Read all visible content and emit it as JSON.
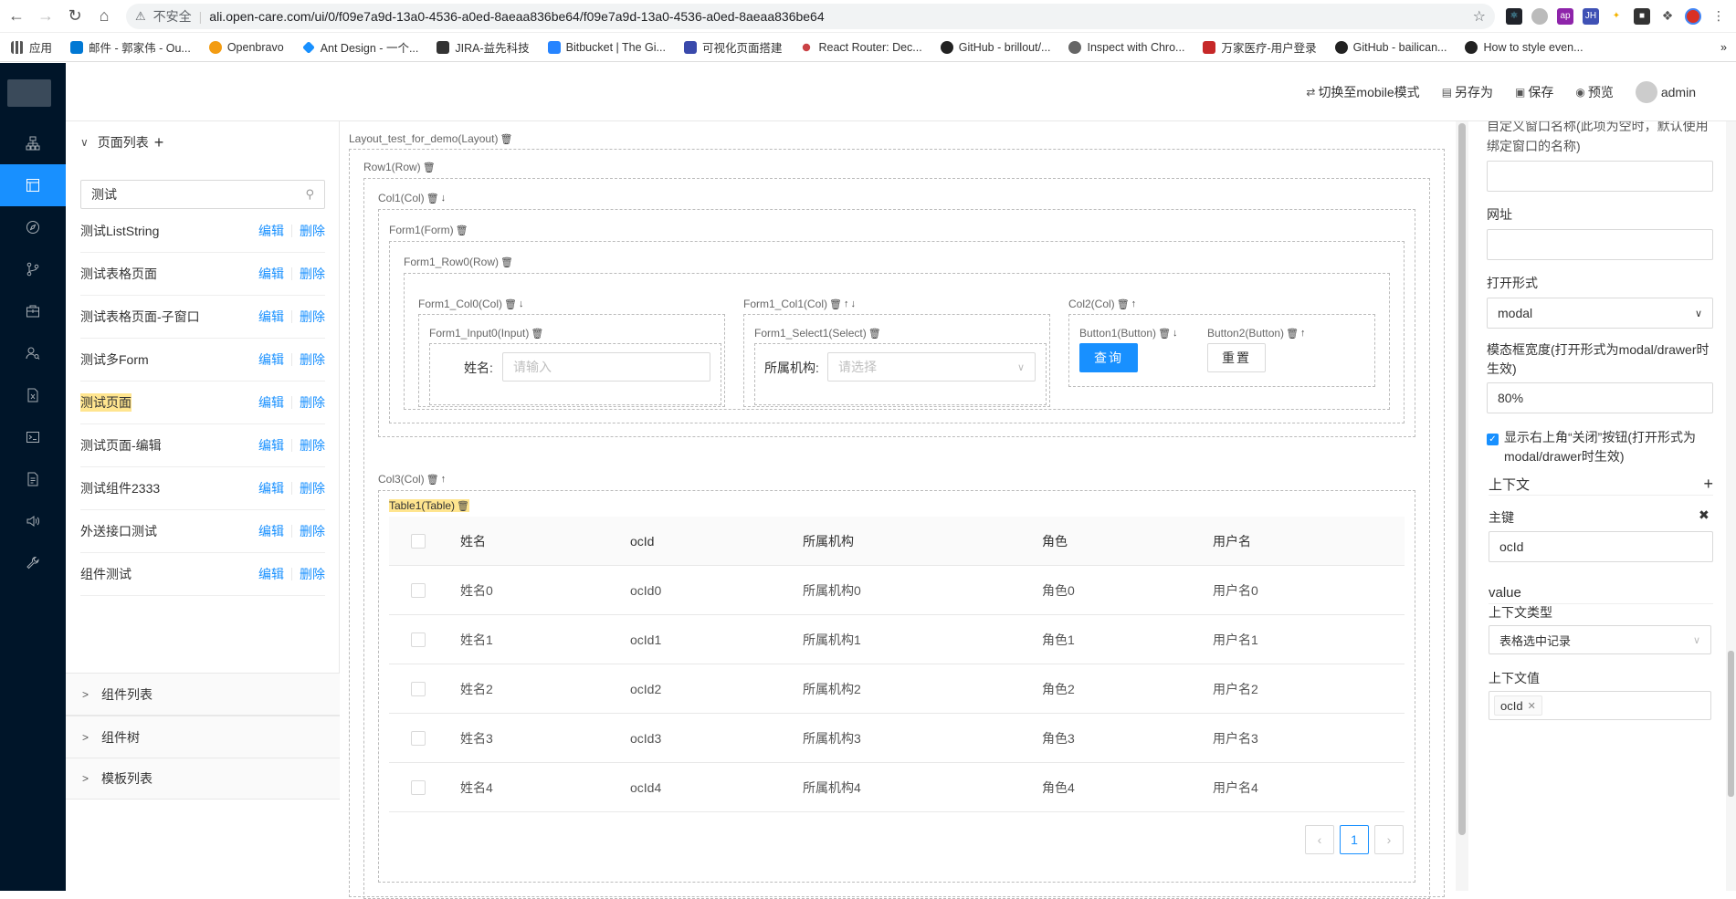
{
  "browser": {
    "not_secure": "不安全",
    "url": "ali.open-care.com/ui/0/f09e7a9d-13a0-4536-a0ed-8aeaa836be64/f09e7a9d-13a0-4536-a0ed-8aeaa836be64",
    "bookmarks": [
      "应用",
      "邮件 - 郭家伟 - Ou...",
      "Openbravo",
      "Ant Design - 一个...",
      "JIRA-益先科技",
      "Bitbucket | The Gi...",
      "可视化页面搭建",
      "React Router: Dec...",
      "GitHub - brillout/...",
      "Inspect with Chro...",
      "万家医疗-用户登录",
      "GitHub - bailican...",
      "How to style even..."
    ]
  },
  "topbar": {
    "switch_mobile": "切换至mobile模式",
    "save_as": "另存为",
    "save": "保存",
    "preview": "预览",
    "user": "admin"
  },
  "left_panel": {
    "page_list_title": "页面列表",
    "search_value": "测试",
    "edit": "编辑",
    "delete": "删除",
    "pages": [
      "测试ListString",
      "测试表格页面",
      "测试表格页面-子窗口",
      "测试多Form",
      "测试页面",
      "测试页面-编辑",
      "测试组件2333",
      "外送接口测试",
      "组件测试"
    ],
    "sections": [
      "组件列表",
      "组件树",
      "模板列表"
    ]
  },
  "canvas": {
    "layout_label": "Layout_test_for_demo(Layout)",
    "row1": "Row1(Row)",
    "col1": "Col1(Col)",
    "form1": "Form1(Form)",
    "form1_row0": "Form1_Row0(Row)",
    "form1_col0": "Form1_Col0(Col)",
    "form1_col1": "Form1_Col1(Col)",
    "col2": "Col2(Col)",
    "input0": "Form1_Input0(Input)",
    "select1": "Form1_Select1(Select)",
    "button1": "Button1(Button)",
    "button2": "Button2(Button)",
    "name_label": "姓名:",
    "name_placeholder": "请输入",
    "org_label": "所属机构:",
    "org_placeholder": "请选择",
    "query_btn": "查询",
    "reset_btn": "重置",
    "col3": "Col3(Col)",
    "table1": "Table1(Table)",
    "columns": [
      "姓名",
      "ocId",
      "所属机构",
      "角色",
      "用户名"
    ],
    "rows": [
      [
        "姓名0",
        "ocId0",
        "所属机构0",
        "角色0",
        "用户名0"
      ],
      [
        "姓名1",
        "ocId1",
        "所属机构1",
        "角色1",
        "用户名1"
      ],
      [
        "姓名2",
        "ocId2",
        "所属机构2",
        "角色2",
        "用户名2"
      ],
      [
        "姓名3",
        "ocId3",
        "所属机构3",
        "角色3",
        "用户名3"
      ],
      [
        "姓名4",
        "ocId4",
        "所属机构4",
        "角色4",
        "用户名4"
      ]
    ],
    "page": "1"
  },
  "props": {
    "window_name_hint": "自定义窗口名称(此项为空时，默认使用绑定窗口的名称)",
    "url_label": "网址",
    "open_mode_label": "打开形式",
    "open_mode_value": "modal",
    "modal_width_label": "模态框宽度(打开形式为modal/drawer时生效)",
    "modal_width_value": "80%",
    "show_close_label": "显示右上角“关闭”按钮(打开形式为modal/drawer时生效)",
    "context_title": "上下文",
    "key_label": "主键",
    "key_value": "ocId",
    "value_title": "value",
    "context_type_label": "上下文类型",
    "context_type_value": "表格选中记录",
    "context_value_label": "上下文值",
    "context_tag": "ocId"
  }
}
